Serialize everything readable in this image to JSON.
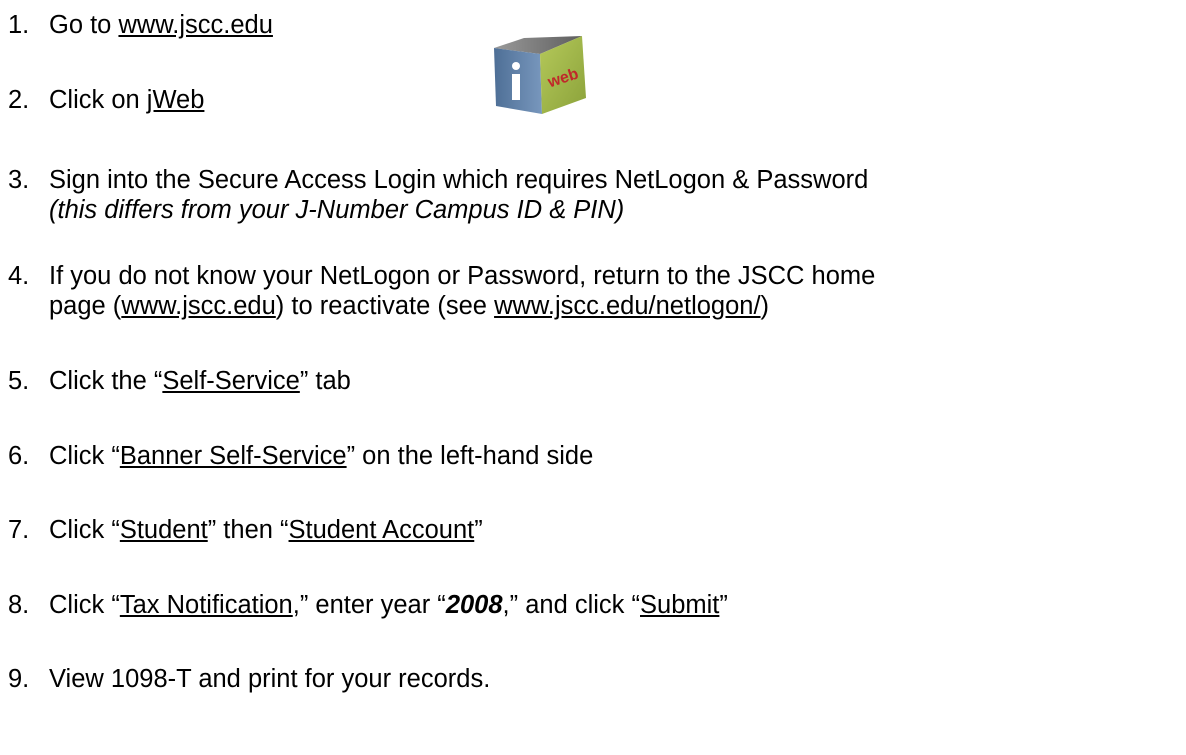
{
  "steps": [
    {
      "num": "1.",
      "a": "Go to ",
      "link": "www.jscc.edu"
    },
    {
      "num": "2.",
      "a": "Click on ",
      "link": "jWeb"
    },
    {
      "num": "3.",
      "line1": "Sign into the Secure Access Login which requires NetLogon & Password",
      "line2": "(this differs from your J-Number Campus ID & PIN)"
    },
    {
      "num": "4.",
      "line1": "If you do not know your NetLogon or Password, return to the JSCC home",
      "b": "page (",
      "link1": "www.jscc.edu",
      "c": ") to reactivate (see ",
      "link2": "www.jscc.edu/netlogon/",
      "d": ")"
    },
    {
      "num": "5.",
      "a": "Click the “",
      "link": "Self-Service",
      "b": "” tab"
    },
    {
      "num": "6.",
      "a": "Click “",
      "link": "Banner Self-Service",
      "b": "” on the left-hand side"
    },
    {
      "num": "7.",
      "a": "Click “",
      "link1": "Student",
      "b": "” then “",
      "link2": "Student Account",
      "c": "”"
    },
    {
      "num": "8.",
      "a": "Click “",
      "link1": "Tax Notification",
      "b": ",” enter year “",
      "year": "2008",
      "c": ",” and click “",
      "link2": "Submit",
      "d": "”"
    },
    {
      "num": "9.",
      "a": "View 1098-T and print for your records."
    }
  ],
  "logo": {
    "icon": "jweb-cube-icon",
    "letter": "i",
    "word": "web",
    "colors": {
      "front": "#5b7fa8",
      "side": "#9eb644",
      "top": "#888888",
      "text_red": "#c0282a"
    }
  }
}
